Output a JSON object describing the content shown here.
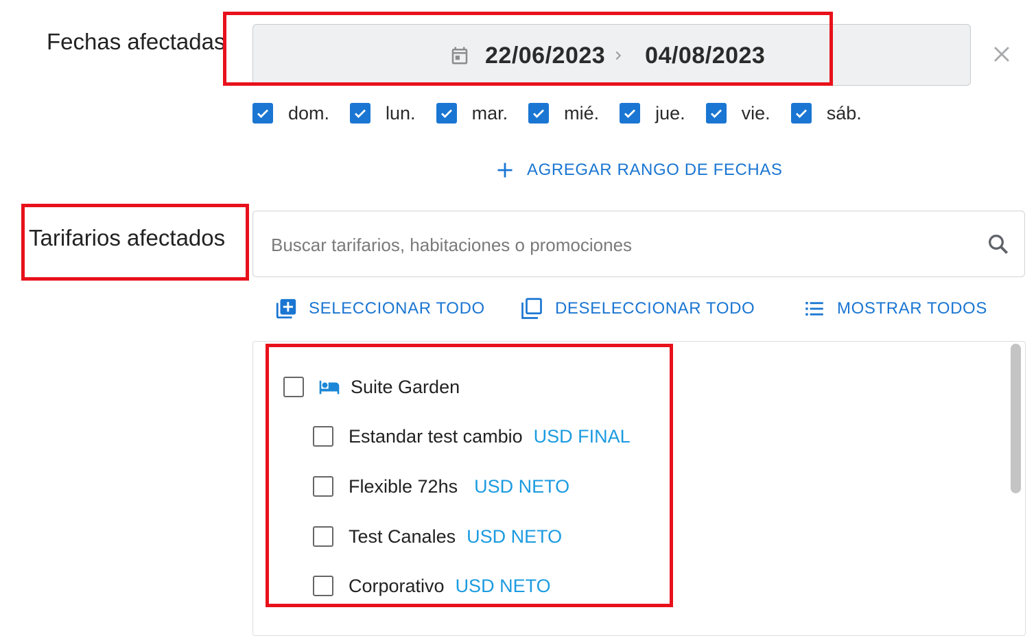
{
  "dates_section": {
    "label": "Fechas afectadas",
    "start_date": "22/06/2023",
    "end_date": "04/08/2023"
  },
  "weekdays": [
    {
      "label": "dom.",
      "checked": true
    },
    {
      "label": "lun.",
      "checked": true
    },
    {
      "label": "mar.",
      "checked": true
    },
    {
      "label": "mié.",
      "checked": true
    },
    {
      "label": "jue.",
      "checked": true
    },
    {
      "label": "vie.",
      "checked": true
    },
    {
      "label": "sáb.",
      "checked": true
    }
  ],
  "add_range_label": "AGREGAR RANGO DE FECHAS",
  "rates_section": {
    "label": "Tarifarios afectados",
    "search_placeholder": "Buscar tarifarios, habitaciones o promociones",
    "select_all_label": "SELECCIONAR TODO",
    "deselect_all_label": "DESELECCIONAR TODO",
    "show_all_label": "MOSTRAR TODOS"
  },
  "room": {
    "name": "Suite Garden",
    "icon": "bed-icon",
    "checked": false,
    "rates": [
      {
        "name": "Estandar test cambio",
        "tag": "USD FINAL",
        "checked": false
      },
      {
        "name": "Flexible 72hs",
        "tag": "USD NETO",
        "checked": false
      },
      {
        "name": "Test Canales",
        "tag": "USD NETO",
        "checked": false
      },
      {
        "name": "Corporativo",
        "tag": "USD NETO",
        "checked": false
      }
    ]
  },
  "colors": {
    "accent": "#1a76d2",
    "tag": "#1b9be0",
    "annotation": "#e8111b"
  }
}
